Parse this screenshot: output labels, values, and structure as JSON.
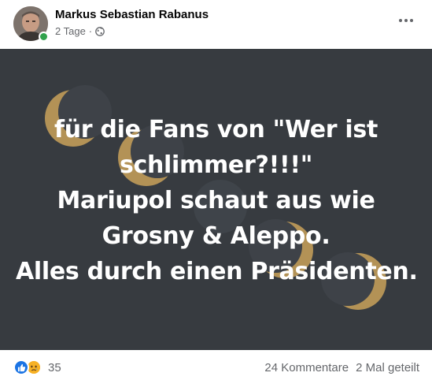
{
  "post": {
    "author": "Markus Sebastian Rabanus",
    "time": "2 Tage",
    "separator": "·",
    "privacy_icon": "globe-icon",
    "more_icon": "more-horizontal-icon",
    "image_text": {
      "lines": [
        "für die Fans von \"Wer ist",
        "schlimmer?!!!\"",
        "Mariupol schaut aus wie",
        "Grosny & Aleppo.",
        "Alles durch einen Präsidenten."
      ]
    },
    "colors": {
      "image_background": "#373b40",
      "moon_gold": "#c9a25a",
      "text": "#ffffff"
    }
  },
  "footer": {
    "reaction_icons": [
      "like-icon",
      "sad-icon"
    ],
    "reaction_count": "35",
    "comments": "24 Kommentare",
    "shares": "2 Mal geteilt"
  }
}
